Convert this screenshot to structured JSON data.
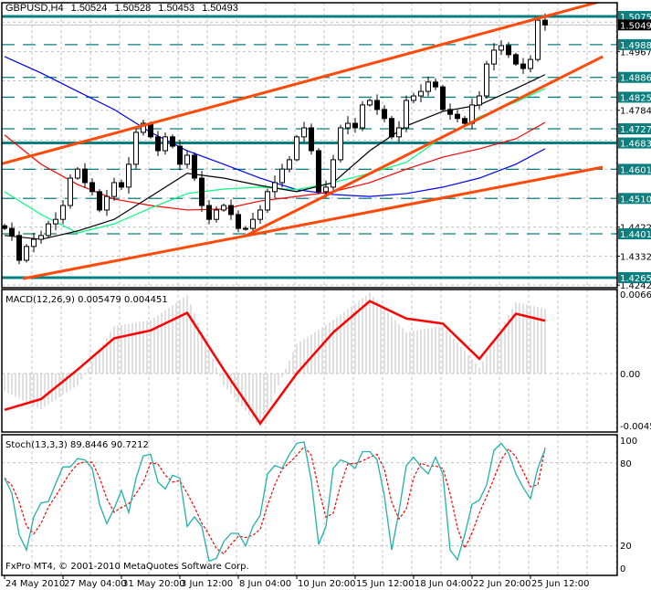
{
  "header": {
    "symbol": "GBPUSD,H4",
    "open": "1.50524",
    "high": "1.50528",
    "low": "1.50453",
    "close": "1.50493"
  },
  "copyright": "FxPro MT4, © 2001-2010 MetaQuotes Software Corp.",
  "colors": {
    "level": "#0a7f7f",
    "trendline": "#ff4a0a",
    "grid": "#c0c0c0",
    "bid_label": "#000000",
    "stoch_k": "#20b2aa",
    "stoch_d": "#ff0000",
    "macd_hist": "#c0c0c0",
    "macd_signal": "#ff0000"
  },
  "chart_data": {
    "type": "candlestick",
    "title": "GBPUSD,H4",
    "price_range": [
      1.424,
      1.5121
    ],
    "closes": [
      1.4418,
      1.4396,
      1.4319,
      1.4362,
      1.4384,
      1.4396,
      1.4432,
      1.4446,
      1.4489,
      1.4574,
      1.4602,
      1.456,
      1.4532,
      1.4475,
      1.4517,
      1.456,
      1.4546,
      1.4617,
      1.4716,
      1.4744,
      1.4702,
      1.4659,
      1.4702,
      1.4673,
      1.4617,
      1.4645,
      1.4574,
      1.4489,
      1.4446,
      1.4475,
      1.4489,
      1.4461,
      1.4418,
      1.4418,
      1.4446,
      1.4475,
      1.4532,
      1.456,
      1.4602,
      1.4631,
      1.4702,
      1.473,
      1.4659,
      1.4532,
      1.4546,
      1.4631,
      1.473,
      1.4744,
      1.473,
      1.4801,
      1.4815,
      1.4787,
      1.4759,
      1.4702,
      1.473,
      1.4815,
      1.4829,
      1.4843,
      1.4872,
      1.4857,
      1.4787,
      1.4772,
      1.4759,
      1.4744,
      1.4801,
      1.4829,
      1.4928,
      1.4971,
      1.4985,
      1.4957,
      1.4928,
      1.4914,
      1.4942,
      1.5064,
      1.50493
    ],
    "sample_indices": [
      0,
      5,
      10,
      15,
      20,
      25,
      30,
      35,
      40,
      45,
      50,
      55,
      60,
      65,
      70,
      74
    ],
    "moving_averages": [
      {
        "name": "ma-blue",
        "color": "#0000ff",
        "values": [
          1.4951,
          1.49,
          1.4843,
          1.4787,
          1.4716,
          1.4659,
          1.4617,
          1.4574,
          1.4538,
          1.4523,
          1.4517,
          1.4526,
          1.4546,
          1.4574,
          1.4617,
          1.4665
        ]
      },
      {
        "name": "ma-red",
        "color": "#ff0000",
        "values": [
          1.4708,
          1.4617,
          1.4554,
          1.4509,
          1.4489,
          1.4475,
          1.4478,
          1.4503,
          1.4517,
          1.4532,
          1.456,
          1.4602,
          1.4639,
          1.4665,
          1.4696,
          1.4747
        ]
      },
      {
        "name": "ma-green",
        "color": "#00ff7f",
        "values": [
          1.4532,
          1.4461,
          1.4404,
          1.4432,
          1.4481,
          1.4526,
          1.454,
          1.4546,
          1.4538,
          1.456,
          1.4589,
          1.4623,
          1.4702,
          1.4764,
          1.481,
          1.4852
        ]
      },
      {
        "name": "ma-black",
        "color": "#000000",
        "values": [
          1.4396,
          1.4384,
          1.441,
          1.4446,
          1.4517,
          1.4589,
          1.4574,
          1.4551,
          1.4532,
          1.456,
          1.4659,
          1.4736,
          1.4781,
          1.4801,
          1.4852,
          1.4895
        ]
      }
    ],
    "trendlines": [
      {
        "name": "upper-channel",
        "from": [
          -0.6,
          1.4617
        ],
        "to": [
          81.9,
          1.5124
        ]
      },
      {
        "name": "middle-channel",
        "from": [
          33.1,
          1.4396
        ],
        "to": [
          81.9,
          1.4951
        ]
      },
      {
        "name": "lower-channel",
        "from": [
          2.5,
          1.4262
        ],
        "to": [
          81.9,
          1.4608
        ]
      }
    ],
    "levels_solid": [
      "1.50756",
      "1.46830",
      "1.42652"
    ],
    "levels_dashed": [
      "1.49881",
      "1.48865",
      "1.48250",
      "1.47270",
      "1.46013",
      "1.45109",
      "1.44011"
    ],
    "bid": "1.50493",
    "grid_prices": [
      1.4242,
      1.4332,
      1.4422,
      1.4512,
      1.4602,
      1.46915,
      1.47845,
      1.4876,
      1.4967,
      1.5058
    ],
    "axis_labels": [
      "1.49670",
      "1.47845",
      "1.44220",
      "1.43320",
      "1.42420"
    ],
    "time_labels": [
      "24 May 2010",
      "27 May 04:00",
      "31 May 20:00",
      "3 Jun 12:00",
      "8 Jun 04:00",
      "10 Jun 20:00",
      "15 Jun 12:00",
      "18 Jun 04:00",
      "22 Jun 20:00",
      "25 Jun 12:00"
    ],
    "macd": {
      "label": "MACD(12,26,9)",
      "main_value": "0.005479",
      "signal_value": "0.004451",
      "axis_labels": [
        "0.00669",
        "0.00",
        "-0.00451"
      ],
      "range": [
        -0.00451,
        0.00669
      ],
      "histogram": [
        -0.0015,
        -0.003,
        -0.001,
        0.004,
        0.0045,
        0.0066,
        -0.001,
        -0.0045,
        0.0025,
        0.0045,
        0.0068,
        0.0035,
        0.004,
        0.0005,
        0.006,
        0.005479
      ],
      "signal": [
        -0.00306,
        -0.00215,
        0.00033,
        0.00297,
        0.00363,
        0.00512,
        0.00033,
        -0.00421,
        0.0,
        0.00347,
        0.0061,
        0.00463,
        0.00421,
        0.00124,
        0.00504,
        0.004451
      ]
    },
    "stoch": {
      "label": "Stoch(13,3,3)",
      "k_value": "89.8446",
      "d_value": "90.7212",
      "axis_labels": [
        "100",
        "80",
        "20",
        "0"
      ],
      "k": [
        69,
        58,
        28,
        17,
        41,
        51,
        52,
        65,
        77,
        77,
        83,
        82,
        76,
        50,
        36,
        47,
        60,
        44,
        69,
        85,
        86,
        66,
        61,
        71,
        69,
        34,
        41,
        34,
        9,
        11,
        23,
        29,
        29,
        20,
        34,
        42,
        72,
        78,
        76,
        86,
        94,
        95,
        67,
        21,
        34,
        76,
        82,
        80,
        76,
        88,
        88,
        82,
        56,
        17,
        45,
        78,
        84,
        77,
        72,
        84,
        72,
        17,
        10,
        28,
        50,
        53,
        64,
        89,
        94,
        87,
        72,
        62,
        54,
        76,
        89.8446
      ]
    }
  }
}
